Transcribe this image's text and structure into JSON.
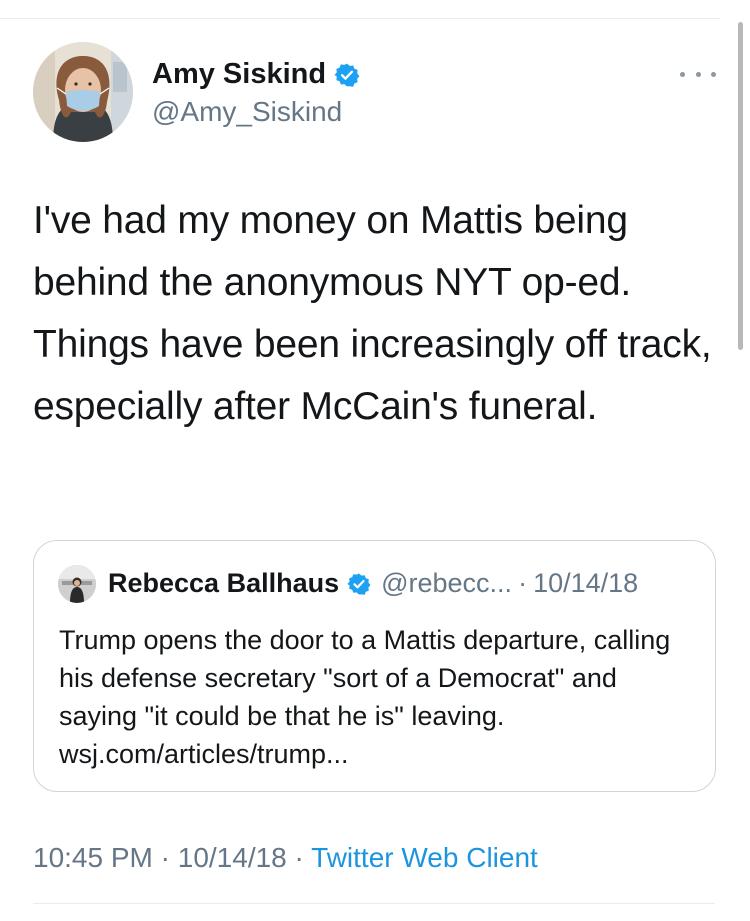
{
  "author": {
    "name": "Amy Siskind",
    "handle": "@Amy_Siskind",
    "verified": true,
    "avatar_icon": "masked-woman-avatar"
  },
  "tweet": {
    "text": "I've had my money on Mattis being behind the anonymous NYT op-ed. Things have been increasingly off track, especially after McCain's funeral."
  },
  "quoted_tweet": {
    "name": "Rebecca Ballhaus",
    "handle": "@rebecc...",
    "separator": "·",
    "date": "10/14/18",
    "verified": true,
    "text": "Trump opens the door to a Mattis departure, calling his defense secretary \"sort of a Democrat\" and saying \"it could be that he is\" leaving. wsj.com/articles/trump..."
  },
  "meta": {
    "time": "10:45 PM",
    "separator1": " · ",
    "date": "10/14/18",
    "separator2": " · ",
    "source": "Twitter Web Client"
  },
  "colors": {
    "verified_blue": "#1da1f2",
    "link_blue": "#1b95e0",
    "secondary_text": "#657786",
    "border": "#ccd6dd"
  },
  "icons": {
    "more": "more-horizontal-icon",
    "verified": "verified-badge-icon"
  }
}
